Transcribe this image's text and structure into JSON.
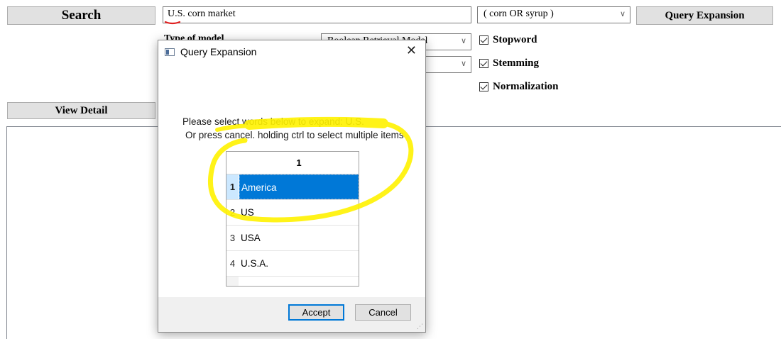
{
  "main": {
    "search_label": "Search",
    "query_value": "U.S. corn market",
    "expansion_combo_value": "( corn OR syrup )",
    "query_expansion_label": "Query Expansion",
    "model_label": "Type of model",
    "model_combo_value": "Boolean Retrieval Model",
    "second_combo_value": "",
    "view_detail_label": "View Detail",
    "checkboxes": [
      {
        "label": "Stopword",
        "checked": true
      },
      {
        "label": "Stemming",
        "checked": true
      },
      {
        "label": "Normalization",
        "checked": true
      }
    ]
  },
  "dialog": {
    "title": "Query Expansion",
    "message_line1": "Please select words below to expand: U.S.",
    "message_line2": "Or press cancel. holding ctrl to select multiple items",
    "column_header": "1",
    "rows": [
      {
        "num": "1",
        "label": "America",
        "selected": true
      },
      {
        "num": "2",
        "label": "US",
        "selected": false
      },
      {
        "num": "3",
        "label": "USA",
        "selected": false
      },
      {
        "num": "4",
        "label": "U.S.A.",
        "selected": false
      }
    ],
    "accept_label": "Accept",
    "cancel_label": "Cancel"
  },
  "icons": {
    "dropdown": "chevron-down-icon",
    "close": "close-icon",
    "window": "window-icon",
    "checkbox": "checkbox-checked-icon",
    "resize": "resize-grip-icon"
  },
  "colors": {
    "selection": "#0078d7",
    "annotation_highlight": "#fff200",
    "annotation_underline": "#e02020"
  }
}
